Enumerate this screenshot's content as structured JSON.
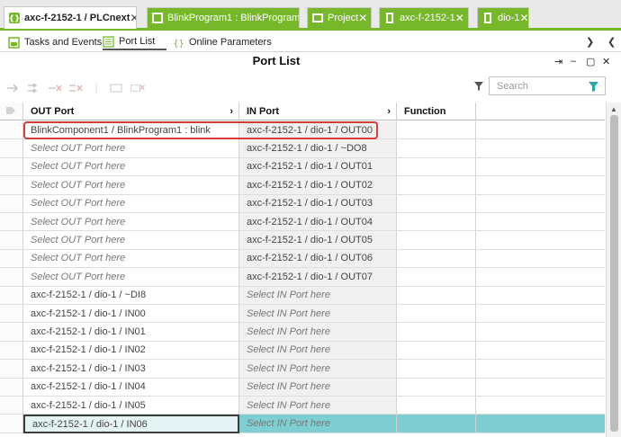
{
  "tabs": [
    {
      "label": "axc-f-2152-1 / PLCnext",
      "close": "✕",
      "icon": "plc-controller-icon"
    },
    {
      "label": "BlinkProgram1 : BlinkProgram",
      "close": "",
      "icon": "program-instance-icon"
    },
    {
      "label": "Project",
      "close": "✕",
      "icon": "project-icon"
    },
    {
      "label": "axc-f-2152-1",
      "close": "✕",
      "icon": "device-icon"
    },
    {
      "label": "dio-1",
      "close": "✕",
      "icon": "io-module-icon"
    }
  ],
  "subtabs": [
    {
      "label": "Tasks and Events",
      "icon": "tasks-events-icon"
    },
    {
      "label": "Port List",
      "icon": "port-list-icon"
    },
    {
      "label": "Online Parameters",
      "icon": "online-parameters-icon"
    }
  ],
  "panel": {
    "title": "Port List",
    "search_placeholder": "Search"
  },
  "columns": {
    "out": "OUT Port",
    "in": "IN Port",
    "function": "Function"
  },
  "rows": [
    {
      "out": "BlinkComponent1 / BlinkProgram1 : blink",
      "in": "axc-f-2152-1 / dio-1 / OUT00",
      "out_placeholder": false,
      "in_placeholder": false
    },
    {
      "out": "Select OUT Port here",
      "in": "axc-f-2152-1 / dio-1 / ~DO8",
      "out_placeholder": true,
      "in_placeholder": false
    },
    {
      "out": "Select OUT Port here",
      "in": "axc-f-2152-1 / dio-1 / OUT01",
      "out_placeholder": true,
      "in_placeholder": false
    },
    {
      "out": "Select OUT Port here",
      "in": "axc-f-2152-1 / dio-1 / OUT02",
      "out_placeholder": true,
      "in_placeholder": false
    },
    {
      "out": "Select OUT Port here",
      "in": "axc-f-2152-1 / dio-1 / OUT03",
      "out_placeholder": true,
      "in_placeholder": false
    },
    {
      "out": "Select OUT Port here",
      "in": "axc-f-2152-1 / dio-1 / OUT04",
      "out_placeholder": true,
      "in_placeholder": false
    },
    {
      "out": "Select OUT Port here",
      "in": "axc-f-2152-1 / dio-1 / OUT05",
      "out_placeholder": true,
      "in_placeholder": false
    },
    {
      "out": "Select OUT Port here",
      "in": "axc-f-2152-1 / dio-1 / OUT06",
      "out_placeholder": true,
      "in_placeholder": false
    },
    {
      "out": "Select OUT Port here",
      "in": "axc-f-2152-1 / dio-1 / OUT07",
      "out_placeholder": true,
      "in_placeholder": false
    },
    {
      "out": "axc-f-2152-1 / dio-1 / ~DI8",
      "in": "Select IN Port here",
      "out_placeholder": false,
      "in_placeholder": true
    },
    {
      "out": "axc-f-2152-1 / dio-1 / IN00",
      "in": "Select IN Port here",
      "out_placeholder": false,
      "in_placeholder": true
    },
    {
      "out": "axc-f-2152-1 / dio-1 / IN01",
      "in": "Select IN Port here",
      "out_placeholder": false,
      "in_placeholder": true
    },
    {
      "out": "axc-f-2152-1 / dio-1 / IN02",
      "in": "Select IN Port here",
      "out_placeholder": false,
      "in_placeholder": true
    },
    {
      "out": "axc-f-2152-1 / dio-1 / IN03",
      "in": "Select IN Port here",
      "out_placeholder": false,
      "in_placeholder": true
    },
    {
      "out": "axc-f-2152-1 / dio-1 / IN04",
      "in": "Select IN Port here",
      "out_placeholder": false,
      "in_placeholder": true
    },
    {
      "out": "axc-f-2152-1 / dio-1 / IN05",
      "in": "Select IN Port here",
      "out_placeholder": false,
      "in_placeholder": true
    },
    {
      "out": "axc-f-2152-1 / dio-1 / IN06",
      "in": "Select IN Port here",
      "out_placeholder": false,
      "in_placeholder": true,
      "selected": true
    }
  ],
  "colors": {
    "accent_green": "#76b82a",
    "selection_teal": "#7fcfd2",
    "highlight_red": "#d93a3a"
  }
}
